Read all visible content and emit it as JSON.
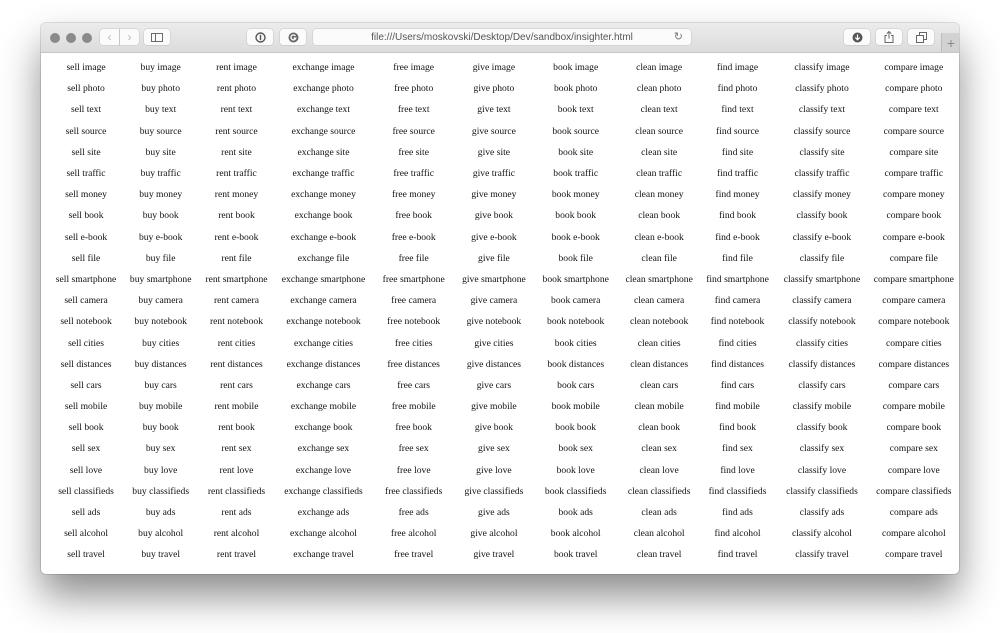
{
  "browser": {
    "url": "file:///Users/moskovski/Desktop/Dev/sandbox/insighter.html",
    "icons": {
      "back": "‹",
      "forward": "›",
      "reload": "↻",
      "new_tab": "+"
    }
  },
  "grid": {
    "verbs": [
      "sell",
      "buy",
      "rent",
      "exchange",
      "free",
      "give",
      "book",
      "clean",
      "find",
      "classify",
      "compare"
    ],
    "nouns": [
      "image",
      "photo",
      "text",
      "source",
      "site",
      "traffic",
      "money",
      "book",
      "e-book",
      "file",
      "smartphone",
      "camera",
      "notebook",
      "cities",
      "distances",
      "cars",
      "mobile",
      "book",
      "sex",
      "love",
      "classifieds",
      "ads",
      "alcohol",
      "travel"
    ]
  }
}
